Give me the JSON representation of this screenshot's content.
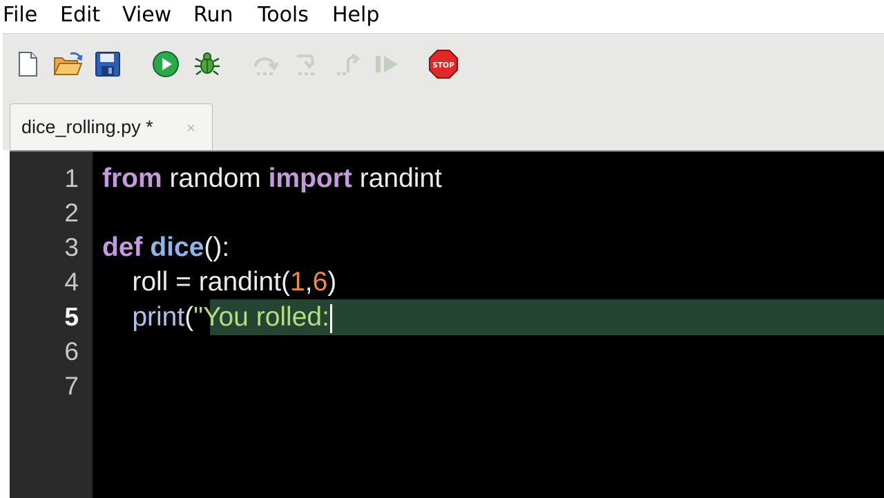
{
  "menu": {
    "file": "File",
    "edit": "Edit",
    "view": "View",
    "run": "Run",
    "tools": "Tools",
    "help": "Help"
  },
  "toolbar": {
    "buttons": [
      {
        "icon": "new-file-icon",
        "enabled": true
      },
      {
        "icon": "open-folder-icon",
        "enabled": true
      },
      {
        "icon": "save-icon",
        "enabled": true
      },
      {
        "icon": "run-icon",
        "enabled": true
      },
      {
        "icon": "debug-bug-icon",
        "enabled": true
      },
      {
        "icon": "step-over-icon",
        "enabled": false
      },
      {
        "icon": "step-into-icon",
        "enabled": false
      },
      {
        "icon": "step-out-icon",
        "enabled": false
      },
      {
        "icon": "resume-icon",
        "enabled": false
      },
      {
        "icon": "stop-icon",
        "enabled": true
      }
    ],
    "stop_text": "STOP"
  },
  "tab": {
    "title": "dice_rolling.py *",
    "close": "×"
  },
  "editor": {
    "current_line": 5,
    "line_numbers": [
      "1",
      "2",
      "3",
      "4",
      "5",
      "6",
      "7"
    ],
    "lines": [
      [
        {
          "t": "from",
          "c": "kw"
        },
        {
          "t": " random ",
          "c": ""
        },
        {
          "t": "import",
          "c": "kw"
        },
        {
          "t": " randint",
          "c": ""
        }
      ],
      [],
      [
        {
          "t": "def",
          "c": "kw"
        },
        {
          "t": " ",
          "c": ""
        },
        {
          "t": "dice",
          "c": "fn"
        },
        {
          "t": "():",
          "c": ""
        }
      ],
      [
        {
          "t": "    roll = randint(",
          "c": ""
        },
        {
          "t": "1",
          "c": "num"
        },
        {
          "t": ",",
          "c": ""
        },
        {
          "t": "6",
          "c": "num"
        },
        {
          "t": ")",
          "c": ""
        }
      ],
      [
        {
          "t": "    ",
          "c": ""
        },
        {
          "t": "print",
          "c": "builtin"
        },
        {
          "t": "(",
          "c": ""
        },
        {
          "t": "\"You rolled:",
          "c": "str"
        }
      ],
      [],
      []
    ]
  },
  "colors": {
    "keyword": "#c49adc",
    "function_name": "#8fb4e8",
    "number": "#f08a3c",
    "string": "#b6dd7c",
    "current_line_bg": "#234532",
    "editor_bg": "#000000",
    "gutter_bg": "#2a2a2a"
  }
}
